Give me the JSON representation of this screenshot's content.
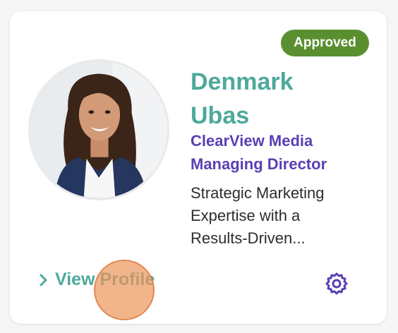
{
  "card": {
    "status_badge": "Approved",
    "name_first": "Denmark",
    "name_last": "Ubas",
    "company": "ClearView Media",
    "title": "Managing Director",
    "description_lines": [
      "Strategic Marketing",
      "Expertise with a",
      "Results-Driven..."
    ],
    "view_profile_label": "View Profile",
    "icons": {
      "chevron": "chevron-right-icon",
      "settings": "gear-icon"
    }
  },
  "colors": {
    "accent_teal": "#4ea99b",
    "accent_purple": "#5a3fb3",
    "badge_green": "#5a8f2f"
  }
}
